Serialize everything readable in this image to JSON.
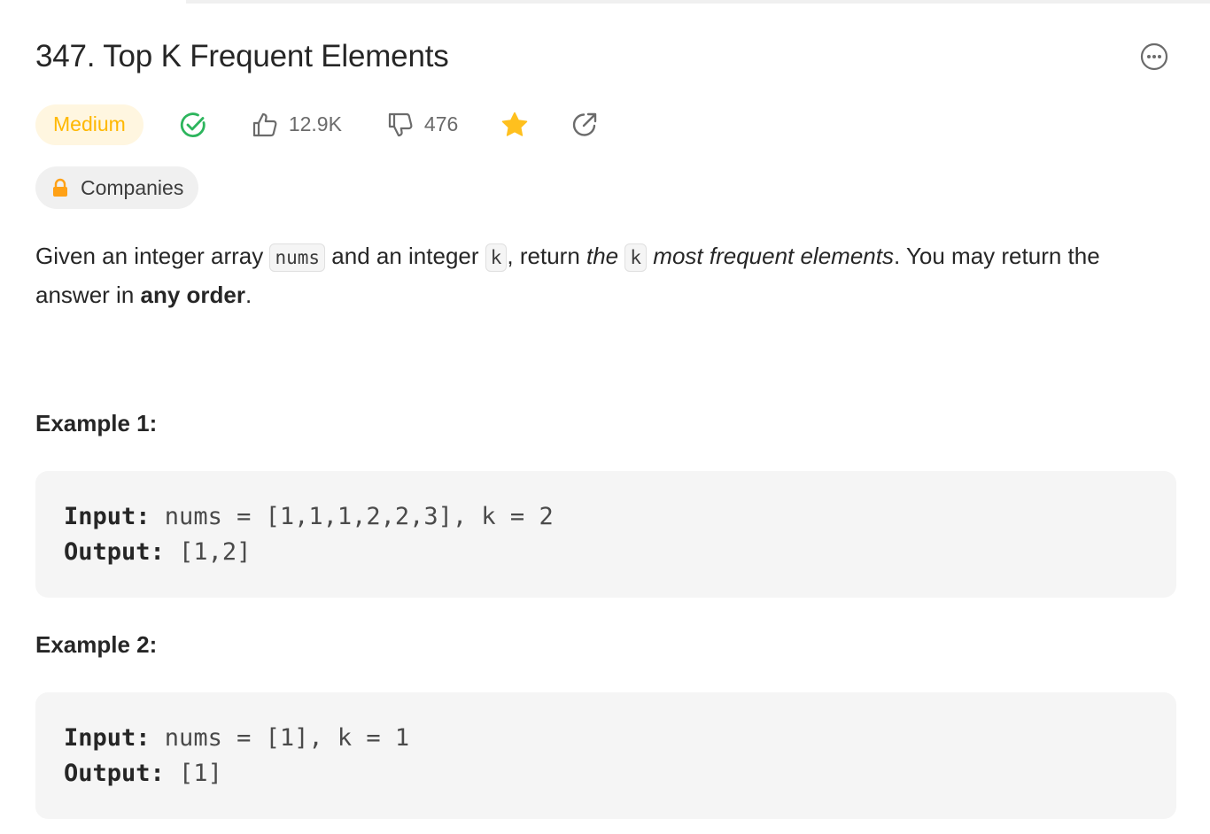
{
  "problem": {
    "title": "347. Top K Frequent Elements",
    "difficulty": "Medium",
    "likes": "12.9K",
    "dislikes": "476",
    "companies_label": "Companies"
  },
  "description": {
    "t1": "Given an integer array ",
    "code_nums": "nums",
    "t2": " and an integer ",
    "code_k": "k",
    "t3": ", return ",
    "em_the": "the",
    "t4": " ",
    "code_k2": "k",
    "t5": " ",
    "em_rest": "most frequent elements",
    "t6": ". You may return the answer in ",
    "strong_order": "any order",
    "t7": "."
  },
  "examples": [
    {
      "title": "Example 1:",
      "input_label": "Input:",
      "input": " nums = [1,1,1,2,2,3], k = 2",
      "output_label": "Output:",
      "output": " [1,2]"
    },
    {
      "title": "Example 2:",
      "input_label": "Input:",
      "input": " nums = [1], k = 1",
      "output_label": "Output:",
      "output": " [1]"
    }
  ],
  "colors": {
    "medium_text": "#ffb800",
    "medium_bg": "#fff6e0",
    "solved_green": "#2db55d",
    "star": "#ffc01e",
    "lock": "#ffa116"
  },
  "icons": [
    "more-options-icon",
    "solved-check-icon",
    "thumbs-up-icon",
    "thumbs-down-icon",
    "star-icon",
    "share-icon",
    "lock-icon"
  ]
}
